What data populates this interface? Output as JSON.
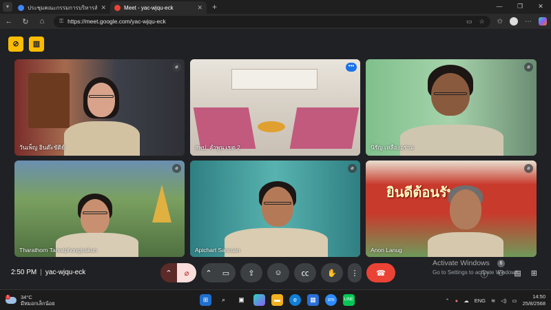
{
  "browser": {
    "tabs": [
      {
        "title": "ประชุมคณะกรรมการบริหารสัญญาจ้างเหมา",
        "active": false,
        "color": "#4285f4"
      },
      {
        "title": "Meet - yac-wjqu-eck",
        "active": true,
        "color": "#ea4335"
      }
    ],
    "new_tab": "+",
    "url": "https://meet.google.com/yac-wjqu-eck"
  },
  "meet": {
    "participants": [
      {
        "name": "วันเพ็ญ อินต๊ะขัติย์",
        "muted": true
      },
      {
        "name": "สพป. ลำพูน เขต 2",
        "muted": false
      },
      {
        "name": "นิรัญ เหลืองอร่าม",
        "muted": true
      },
      {
        "name": "Tharathorn Tanwiphongtrakun",
        "muted": true
      },
      {
        "name": "Apichart Sanruan",
        "muted": true
      },
      {
        "name": "Anon Lanug",
        "muted": true
      }
    ],
    "banner_text": "ยินดีต้อนรับ",
    "time": "2:50 PM",
    "meeting_code": "yac-wjqu-eck",
    "chat_badge": "6"
  },
  "watermark": {
    "line1": "Activate Windows",
    "line2": "Go to Settings to activate Windows."
  },
  "taskbar": {
    "temperature": "34°C",
    "weather_text": "มีหมอกเล็กน้อย",
    "weather_alert": "1",
    "lang": "ENG",
    "clock_time": "14:50",
    "clock_date": "25/8/2568"
  }
}
